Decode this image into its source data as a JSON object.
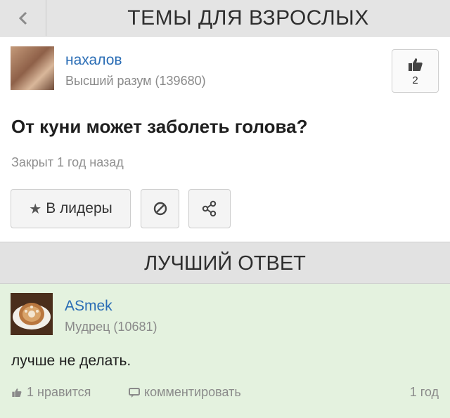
{
  "header": {
    "title": "ТЕМЫ ДЛЯ ВЗРОСЛЫХ",
    "back_icon": "chevron-left-icon"
  },
  "question": {
    "author": {
      "name": "нахалов",
      "rank": "Высший разум (139680)"
    },
    "likes": "2",
    "title": "От куни может заболеть голова?",
    "status": "Закрыт 1 год назад",
    "leaders_button": "В лидеры",
    "icons": {
      "like": "thumbs-up-icon",
      "star": "star-icon",
      "block": "block-icon",
      "share": "share-icon"
    }
  },
  "best_answer": {
    "header": "ЛУЧШИЙ ОТВЕТ",
    "author": {
      "name": "ASmek",
      "rank": "Мудрец (10681)"
    },
    "text": "лучше не делать.",
    "likes_label": "1 нравится",
    "comment_label": "комментировать",
    "time": "1 год",
    "background_color": "#e4f2df"
  },
  "colors": {
    "link": "#2a6db5",
    "muted": "#8a8a8a",
    "header_bg": "#e4e4e4"
  }
}
